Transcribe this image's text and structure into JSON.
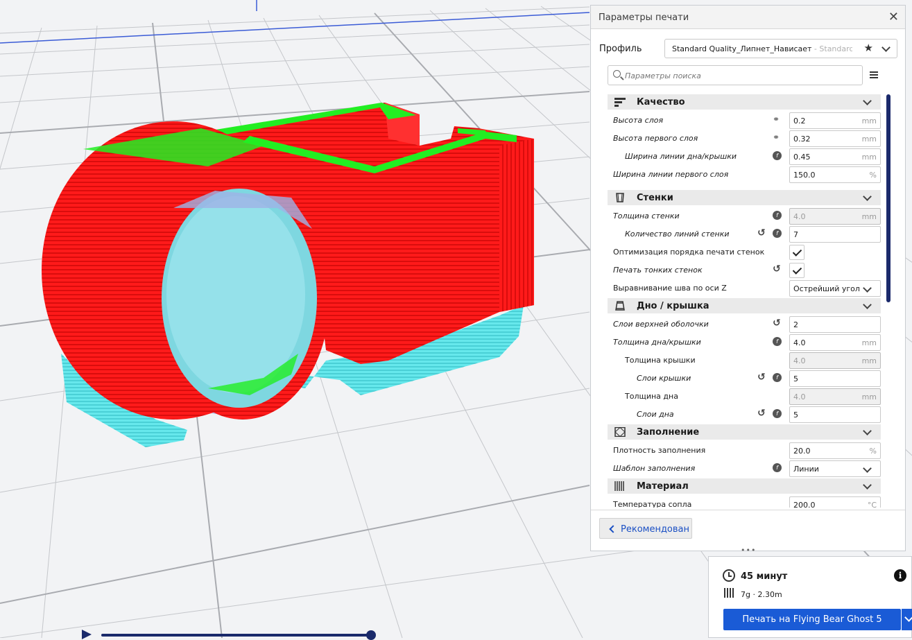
{
  "panel": {
    "title": "Параметры печати",
    "close": "✕",
    "profile_label": "Профиль",
    "profile_value": "Standard Quality_Липнет_Нависает",
    "profile_value_sub": " - Standard Q...",
    "search_placeholder": "Параметры поиска",
    "recommend_label": "Рекомендован"
  },
  "sections": {
    "quality": {
      "title": "Качество",
      "icon": "quality-icon"
    },
    "walls": {
      "title": "Стенки",
      "icon": "walls-icon"
    },
    "bottom_top": {
      "title": "Дно / крышка",
      "icon": "top-bottom-icon"
    },
    "infill": {
      "title": "Заполнение",
      "icon": "infill-icon"
    },
    "material": {
      "title": "Материал",
      "icon": "material-icon"
    }
  },
  "settings": {
    "layer_height": {
      "label": "Высота слоя",
      "value": "0.2",
      "unit": "mm"
    },
    "initial_layer_height": {
      "label": "Высота первого слоя",
      "value": "0.32",
      "unit": "mm"
    },
    "top_bottom_line_width": {
      "label": "Ширина линии дна/крышки",
      "value": "0.45",
      "unit": "mm"
    },
    "initial_layer_line_width": {
      "label": "Ширина линии первого слоя",
      "value": "150.0",
      "unit": "%"
    },
    "wall_thickness": {
      "label": "Толщина стенки",
      "value": "4.0",
      "unit": "mm"
    },
    "wall_line_count": {
      "label": "Количество линий стенки",
      "value": "7",
      "unit": ""
    },
    "optimize_wall_order": {
      "label": "Оптимизация порядка печати стенок",
      "checked": true
    },
    "print_thin_walls": {
      "label": "Печать тонких стенок",
      "checked": true
    },
    "z_seam_alignment": {
      "label": "Выравнивание шва по оси Z",
      "value": "Острейший угол"
    },
    "top_layers_shell": {
      "label": "Слои верхней оболочки",
      "value": "2",
      "unit": ""
    },
    "top_bottom_thickness": {
      "label": "Толщина дна/крышки",
      "value": "4.0",
      "unit": "mm"
    },
    "top_thickness": {
      "label": "Толщина крышки",
      "value": "4.0",
      "unit": "mm"
    },
    "top_layers": {
      "label": "Слои крышки",
      "value": "5",
      "unit": ""
    },
    "bottom_thickness": {
      "label": "Толщина дна",
      "value": "4.0",
      "unit": "mm"
    },
    "bottom_layers": {
      "label": "Слои дна",
      "value": "5",
      "unit": ""
    },
    "infill_density": {
      "label": "Плотность заполнения",
      "value": "20.0",
      "unit": "%"
    },
    "infill_pattern": {
      "label": "Шаблон заполнения",
      "value": "Линии"
    },
    "nozzle_temperature": {
      "label": "Температура сопла",
      "value": "200.0",
      "unit": "°C"
    }
  },
  "job": {
    "time": "45 минут",
    "material": "7g · 2.30m",
    "print_label": "Печать на Flying Bear Ghost 5"
  },
  "colors": {
    "accent": "#1a5bd6",
    "model_red": "#ff1a1a",
    "model_green": "#22ee22",
    "support_cyan": "#66e8ec",
    "build_plate": "#f2f3f5"
  }
}
